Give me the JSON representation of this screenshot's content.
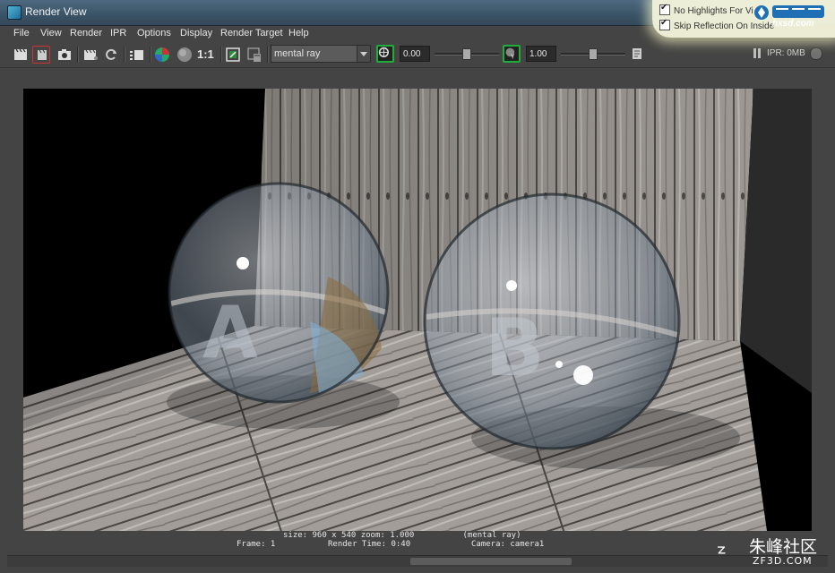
{
  "window": {
    "title": "Render View"
  },
  "menu": [
    "File",
    "View",
    "Render",
    "IPR",
    "Options",
    "Display",
    "Render Target",
    "Help"
  ],
  "toolbar": {
    "one_to_one_label": "1:1",
    "renderer": "mental ray",
    "exposure_value": "0.00",
    "gamma_value": "1.00",
    "ipr_memory": "IPR: 0MB",
    "exposure_fraction": 0.5,
    "gamma_fraction": 0.5
  },
  "overlay": {
    "option1": "No Highlights For Vi",
    "option2": "Skip Reflection On Inside",
    "watermark_text": "hxsd.com"
  },
  "hud": {
    "line1": "size: 960 x 540 zoom: 1.000          (mental ray)",
    "frame": "Frame: 1",
    "render_time": "Render Time: 0:40",
    "camera": "Camera: camera1"
  },
  "watermark": {
    "chinese": "朱峰社区",
    "domain": "ZF3D.COM"
  },
  "colors": {
    "titlebar": "#3a5366",
    "ui_bg": "#444444",
    "wood_light": "#a7a3a0",
    "wood_dark": "#5e5955"
  },
  "icons": [
    "render-frame-icon",
    "render-region-icon",
    "snapshot-icon",
    "ipr-render-icon",
    "refresh-icon",
    "render-sequence-icon",
    "rgb-channels-icon",
    "alpha-channel-icon",
    "keep-image-icon",
    "remove-image-icon",
    "exposure-icon",
    "gamma-icon",
    "display-settings-icon"
  ]
}
